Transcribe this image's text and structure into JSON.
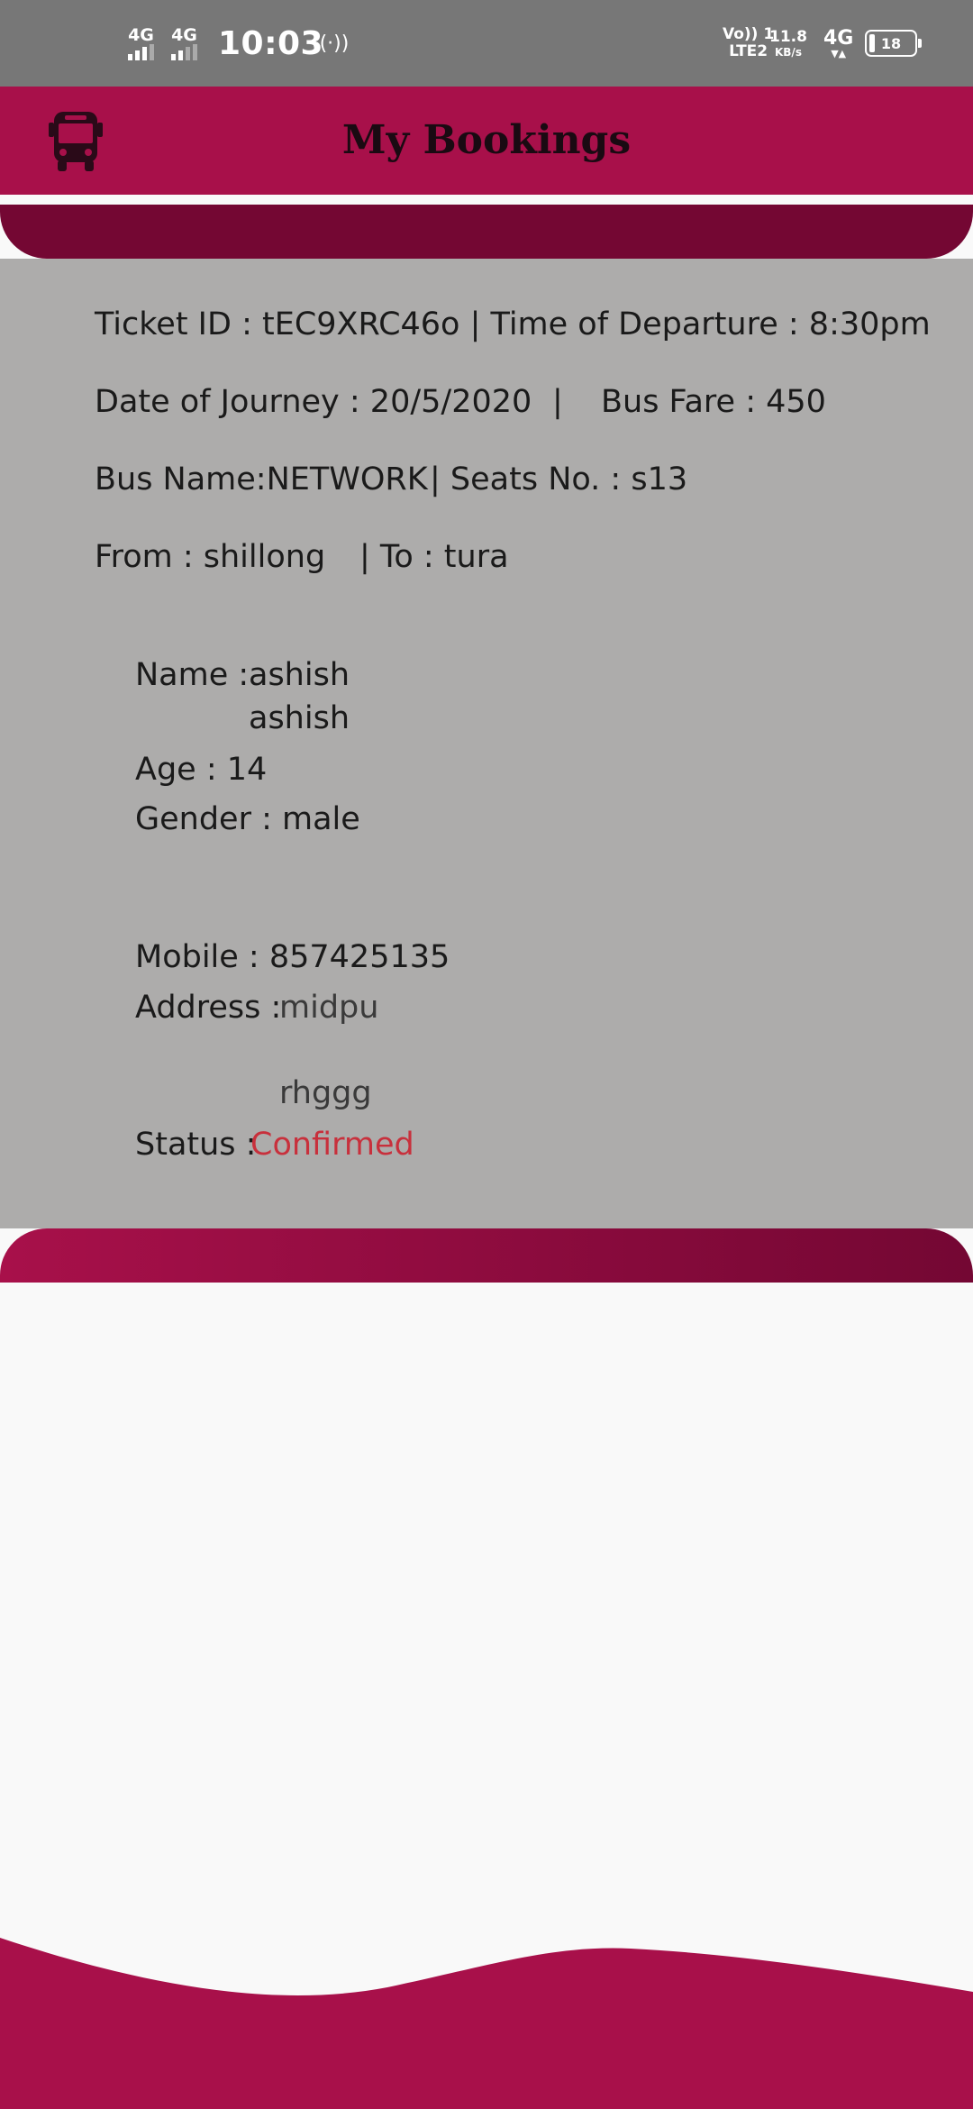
{
  "colors": {
    "primary": "#a8104a",
    "primary_dark": "#740733",
    "card_bg": "#adacab",
    "page_bg": "#f9f9f9",
    "status_confirmed": "#c8303c"
  },
  "status_bar": {
    "sim1": "4G",
    "sim2": "4G",
    "time": "10:03",
    "volte_top": "Vo)) 1",
    "volte_bottom": "LTE2",
    "speed_value": "11.8",
    "speed_unit": "KB/s",
    "network": "4G",
    "battery": "18"
  },
  "header": {
    "title": "My Bookings",
    "icon": "bus-icon"
  },
  "booking": {
    "ticket_line": "Ticket ID : tEC9XRC46o  | Time of Departure : 8:30pm",
    "date_line": "Date of Journey : 20/5/2020",
    "separator": "|",
    "fare_line": "Bus Fare : 450",
    "bus_name_line": "Bus Name:NETWORK",
    "seats_line": "| Seats No. :  s13",
    "from_line": "From : shillong",
    "to_line": "| To : tura",
    "name_label": "Name : ",
    "name_value_1": "ashish",
    "name_value_2": "ashish",
    "age_line": "Age : 14",
    "gender_line": "Gender : male",
    "mobile_line": "Mobile : 857425135",
    "address_label": "Address : ",
    "address_value_1": "midpu",
    "address_value_2": "rhggg",
    "status_label": "Status : ",
    "status_value": "Confirmed"
  }
}
